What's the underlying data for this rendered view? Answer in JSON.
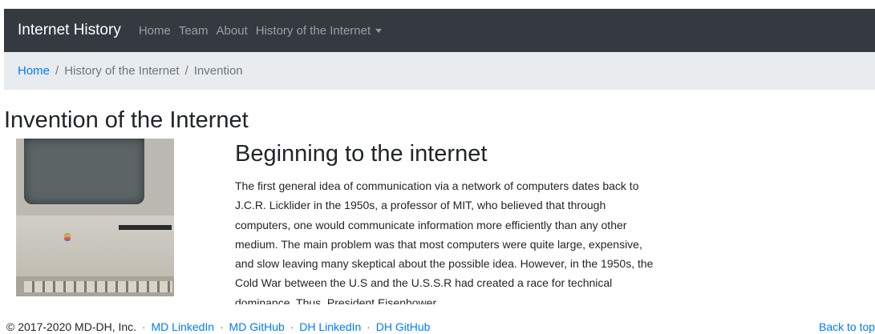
{
  "navbar": {
    "brand": "Internet History",
    "links": [
      "Home",
      "Team",
      "About",
      "History of the Internet"
    ]
  },
  "breadcrumb": {
    "home": "Home",
    "section": "History of the Internet",
    "current": "Invention",
    "separator": "/"
  },
  "page": {
    "title": "Invention of the Internet",
    "image_alt": "vintage computer",
    "article_title": "Beginning to the internet",
    "article_body": "The first general idea of communication via a network of computers dates back to J.C.R. Licklider in the 1950s, a professor of MIT, who believed that through computers, one would communicate information more efficiently than any other medium. The main problem was that most computers were quite large, expensive, and slow leaving many skeptical about the possible idea. However, in the 1950s, the Cold War between the U.S and the U.S.S.R had created a race for technical dominance. Thus, President Eisenhower"
  },
  "footer": {
    "copyright": "© 2017-2020 MD-DH, Inc.",
    "links": [
      "MD LinkedIn",
      "MD GitHub",
      "DH LinkedIn",
      "DH GitHub"
    ],
    "back_to_top": "Back to top"
  },
  "colors": {
    "navbar_bg": "#343a40",
    "breadcrumb_bg": "#e9ecef",
    "link": "#007bff"
  }
}
